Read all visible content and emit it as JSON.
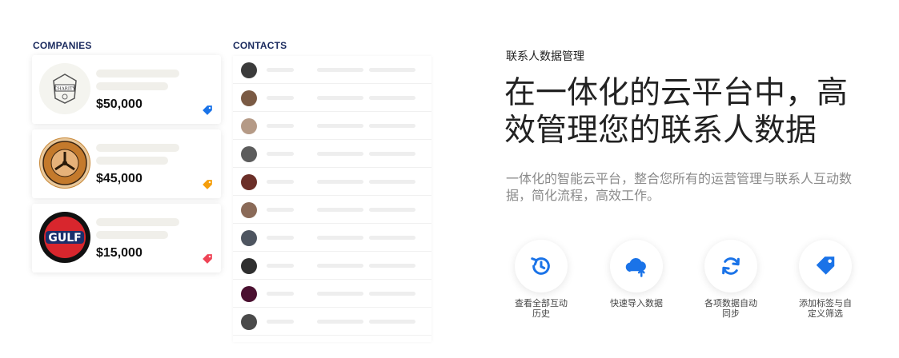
{
  "companies": {
    "label": "COMPANIES",
    "cards": [
      {
        "logo": "charity-seal-logo",
        "amount": "$50,000",
        "tag_color": "#1a73e8"
      },
      {
        "logo": "news-league-logo",
        "amount": "$45,000",
        "tag_color": "#f59e0b"
      },
      {
        "logo": "gulf-logo",
        "logo_text": "GULF",
        "amount": "$15,000",
        "tag_color": "#ef4456"
      }
    ]
  },
  "contacts": {
    "label": "CONTACTS",
    "row_count": 10
  },
  "hero": {
    "eyebrow": "联系人数据管理",
    "headline": "在一体化的云平台中，高效管理您的联系人数据",
    "subtitle": "一体化的智能云平台，整合您所有的运营管理与联系人互动数据，简化流程，高效工作。"
  },
  "features": [
    {
      "icon": "history-icon",
      "label": "查看全部互动历史"
    },
    {
      "icon": "cloud-upload-icon",
      "label": "快速导入数据"
    },
    {
      "icon": "sync-icon",
      "label": "各项数据自动同步"
    },
    {
      "icon": "tag-icon",
      "label": "添加标签与自定义筛选"
    }
  ],
  "colors": {
    "accent": "#1a73e8",
    "section_label": "#1a2a5e"
  }
}
